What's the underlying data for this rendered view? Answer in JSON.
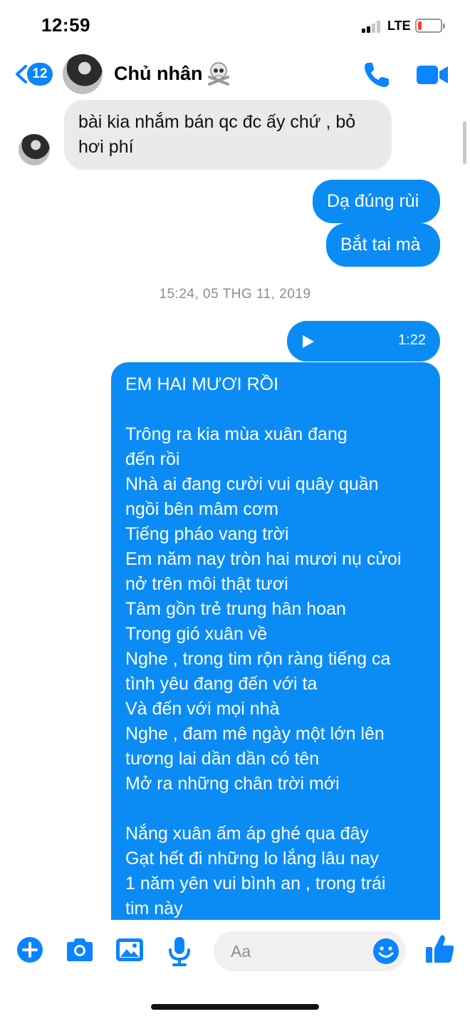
{
  "status": {
    "time": "12:59",
    "network": "LTE"
  },
  "header": {
    "back_count": "12",
    "contact_name": "Chủ nhân",
    "name_emoji": "☠️"
  },
  "messages": {
    "incoming_1": "bài kia nhắm bán qc đc ấy chứ , bỏ hơi phí",
    "outgoing_1": "Dạ đúng rùi",
    "outgoing_2": "Bắt tai mà",
    "timestamp": "15:24, 05 THG 11, 2019",
    "audio_duration": "1:22",
    "lyrics": {
      "line_01": "EM HAI MƯƠI RỒI",
      "line_02": "Trông ra kia mùa xuân đang",
      "line_03": "đến rồi",
      "line_04": "Nhà ai đang cười vui quây quần",
      "line_05": "ngồi bên mâm cơm",
      "line_06": "Tiếng pháo vang trời",
      "line_07": "Em năm nay tròn hai mươi nụ cửoi",
      "line_08": "nở trên môi thật tươi",
      "line_09": "Tâm gồn trẻ trung hân hoan",
      "line_10": "Trong gió xuân về",
      "line_11": "Nghe , trong tim rộn ràng tiếng ca",
      "line_12": "tình yêu đang đến với ta",
      "line_13": "Và đến với mọi nhà",
      "line_14": "Nghe , đam mê ngày một lớn lên",
      "line_15": "tương lai dần dần có tên",
      "line_16": "Mở ra những chân trời mới",
      "line_17": "Nắng xuân ấm áp ghé qua đây",
      "line_18": "Gạt hết đi những lo lắng lâu nay",
      "line_19": "1 năm yên vui bình an , trong trái",
      "line_20": "tim này"
    }
  },
  "composer": {
    "placeholder": "Aa"
  },
  "colors": {
    "accent": "#0a84ff",
    "outgoing_bubble": "#0b8cf4",
    "incoming_bubble": "#eaeaea",
    "battery_low": "#ff3b30"
  },
  "icons": {
    "back": "chevron-left-icon",
    "call": "phone-icon",
    "video": "video-camera-icon",
    "play": "play-icon",
    "add": "plus-circle-icon",
    "camera": "camera-icon",
    "gallery": "image-icon",
    "mic": "microphone-icon",
    "emoji": "smiley-icon",
    "like": "thumbs-up-icon"
  }
}
